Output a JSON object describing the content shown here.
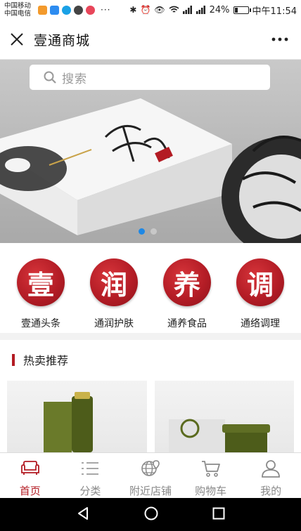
{
  "status_bar": {
    "carrier_1": "中国移动",
    "carrier_2": "中国电信",
    "dots": "···",
    "battery_text": "24%",
    "battery_level": 0.24,
    "time": "中午11:54"
  },
  "header": {
    "title": "壹通商城"
  },
  "search": {
    "placeholder": "搜索"
  },
  "banner": {
    "slide_count": 2,
    "active_slide": 1
  },
  "categories": [
    {
      "char": "壹",
      "label": "壹通头条"
    },
    {
      "char": "润",
      "label": "通润护肤"
    },
    {
      "char": "养",
      "label": "通养食品"
    },
    {
      "char": "调",
      "label": "通络调理"
    }
  ],
  "hot": {
    "title": "热卖推荐"
  },
  "tabs": [
    {
      "label": "首页",
      "icon": "sofa-icon",
      "active": true
    },
    {
      "label": "分类",
      "icon": "list-icon",
      "active": false
    },
    {
      "label": "附近店铺",
      "icon": "globe-pin-icon",
      "active": false
    },
    {
      "label": "购物车",
      "icon": "cart-icon",
      "active": false
    },
    {
      "label": "我的",
      "icon": "user-icon",
      "active": false
    }
  ],
  "colors": {
    "brand_red": "#b31b23",
    "indicator_blue": "#1e88e5"
  }
}
